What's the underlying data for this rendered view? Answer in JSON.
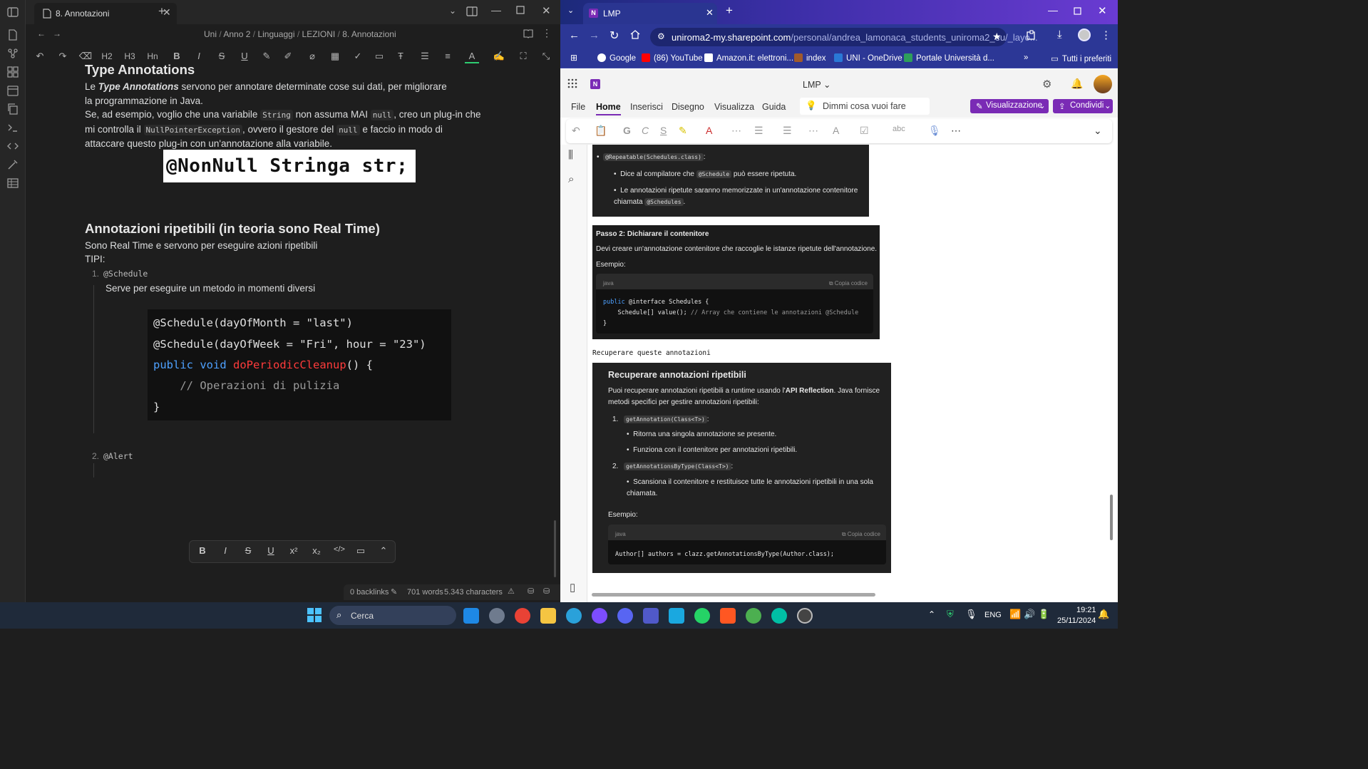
{
  "obsidian": {
    "tab_title": "8. Annotazioni",
    "breadcrumb": [
      "Uni",
      "Anno 2",
      "Linguaggi",
      "LEZIONI",
      "8. Annotazioni"
    ],
    "toolbar": [
      "H2",
      "H3",
      "Hn",
      "B",
      "I",
      "S",
      "U"
    ],
    "section1": {
      "heading": "Type Annotations",
      "p1_a": "Le ",
      "p1_em": "Type Annotations",
      "p1_b": " servono per annotare determinate cose sui dati, per migliorare la programmazione in Java.",
      "p2_a": "Se, ad esempio, voglio che una variabile ",
      "p2_code1": "String",
      "p2_b": " non assuma MAI ",
      "p2_code2": "null",
      "p2_c": ", creo un plug-in che mi controlla il ",
      "p2_code3": "NullPointerException",
      "p2_d": ", ovvero il gestore del ",
      "p2_code4": "null",
      "p2_e": " e faccio in modo di attaccare questo plug-in con un'annotazione alla variabile.",
      "image_text": "@NonNull Stringa str;"
    },
    "section2": {
      "heading": "Annotazioni ripetibili (in teoria sono Real Time)",
      "intro": "Sono Real Time e servono per eseguire azioni ripetibili",
      "tipi": "TIPI:",
      "item1_num": "1.",
      "item1_code": "@Schedule",
      "item1_desc": "Serve per eseguire un metodo in momenti diversi",
      "code_lines": {
        "l1": "@Schedule(dayOfMonth = \"last\")",
        "l2": "@Schedule(dayOfWeek = \"Fri\", hour = \"23\")",
        "l3_kw1": "public",
        "l3_kw2": "void",
        "l3_fn": "doPeriodicCleanup",
        "l3_rest": "() {",
        "l4": "    // Operazioni di pulizia",
        "l5": "}"
      },
      "item2_num": "2.",
      "item2_code": "@Alert"
    },
    "status": {
      "backlinks": "0 backlinks",
      "words": "701 words",
      "chars": "5.343 characters"
    }
  },
  "chrome": {
    "tab_title": "LMP",
    "url_host": "uniroma2-my.sharepoint.com",
    "url_path": "/personal/andrea_lamonaca_students_uniroma2_eu/_layo...",
    "bookmarks": [
      {
        "label": "Google",
        "color": "#ffffff"
      },
      {
        "label": "(86) YouTube",
        "color": "#ff0000"
      },
      {
        "label": "Amazon.it: elettroni...",
        "color": "#ffffff"
      },
      {
        "label": "index",
        "color": "#a05a2c"
      },
      {
        "label": "UNI - OneDrive",
        "color": "#2a78d6"
      },
      {
        "label": "Portale Università d...",
        "color": "#2e9e5b"
      }
    ],
    "bookmarks_all": "Tutti i preferiti"
  },
  "onenote": {
    "title": "LMP",
    "menu": [
      "File",
      "Home",
      "Inserisci",
      "Disegno",
      "Visualizza",
      "Guida"
    ],
    "search_placeholder": "Dimmi cosa vuoi fare",
    "view_button": "Visualizzazione",
    "share_button": "Condividi",
    "block1": {
      "code": "@Repeatable(Schedules.class)",
      "colon": ":",
      "b1_a": "Dice al compilatore che ",
      "b1_code": "@Schedule",
      "b1_b": " può essere ripetuta.",
      "b2": "Le annotazioni ripetute saranno memorizzate in un'annotazione contenitore chiamata ",
      "b2_code": "@Schedules",
      "b2_end": "."
    },
    "block2": {
      "heading": "Passo 2: Dichiarare il contenitore",
      "desc": "Devi creare un'annotazione contenitore che raccoglie le istanze ripetute dell'annotazione.",
      "esempio": "Esempio:",
      "lang": "java",
      "copy": "Copia codice",
      "code_l1_kw": "public",
      "code_l1_rest": " @interface Schedules {",
      "code_l2": "    Schedule[] value();",
      "code_l2_cm": " // Array che contiene le annotazioni @Schedule",
      "code_l3": "}"
    },
    "mono_text": "Recuperare queste annotazioni",
    "block3": {
      "heading": "Recuperare annotazioni ripetibili",
      "p_a": "Puoi recuperare annotazioni ripetibili a runtime usando l'",
      "p_b": "API Reflection",
      "p_c": ". Java fornisce metodi specifici per gestire annotazioni ripetibili:",
      "item1_num": "1.",
      "item1_code": "getAnnotation(Class<T>)",
      "item1_b1": "Ritorna una singola annotazione se presente.",
      "item1_b2": "Funziona con il contenitore per annotazioni ripetibili.",
      "item2_num": "2.",
      "item2_code": "getAnnotationsByType(Class<T>)",
      "item2_b1": "Scansiona il contenitore e restituisce tutte le annotazioni ripetibili in una sola chiamata.",
      "esempio": "Esempio:",
      "lang": "java",
      "copy": "Copia codice",
      "code": "Author[] authors = clazz.getAnnotationsByType(Author.class);"
    }
  },
  "taskbar": {
    "search": "Cerca",
    "lang": "ENG",
    "time": "19:21",
    "date": "25/11/2024"
  }
}
